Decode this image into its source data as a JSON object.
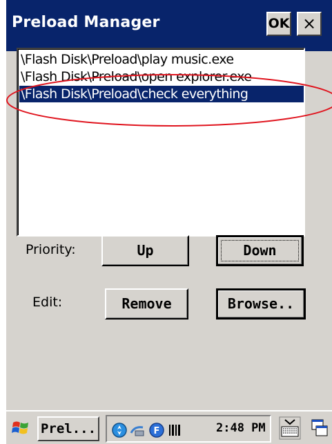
{
  "window": {
    "title": "Preload Manager",
    "ok_label": "OK",
    "close_label": "×"
  },
  "list": {
    "items": [
      "\\Flash Disk\\Preload\\play music.exe",
      "\\Flash Disk\\Preload\\open explorer.exe",
      "\\Flash Disk\\Preload\\check everything"
    ],
    "selected_index": 2
  },
  "priority": {
    "label": "Priority:",
    "up_label": "Up",
    "down_label": "Down"
  },
  "edit": {
    "label": "Edit:",
    "remove_label": "Remove",
    "browse_label": "Browse.."
  },
  "taskbar": {
    "task_label": "Prel...",
    "clock": "2:48 PM",
    "tray_icons": [
      "network-icon",
      "connection-icon",
      "f-key-icon",
      "barcode-icon"
    ]
  },
  "colors": {
    "title_bar": "#08246b",
    "selection": "#08246b",
    "window_face": "#d6d3ce",
    "annotation_circle": "#e0141e"
  }
}
